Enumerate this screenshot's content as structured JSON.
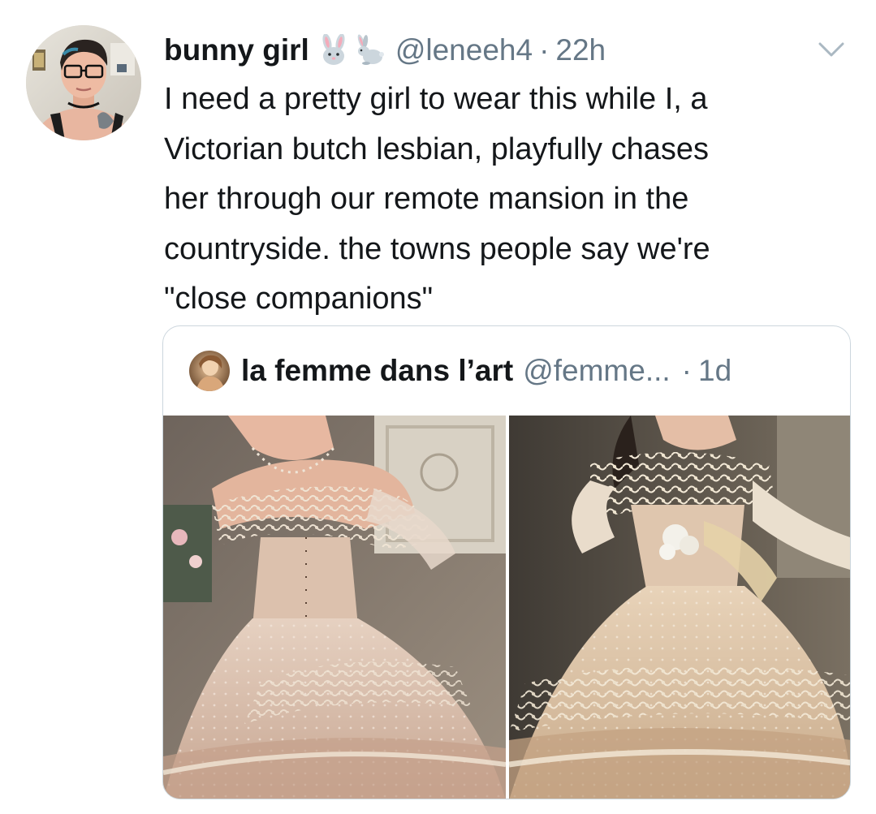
{
  "tweet": {
    "display_name": "bunny girl",
    "emojis": [
      "rabbit-face-emoji",
      "rabbit-emoji"
    ],
    "handle": "@leneeh4",
    "separator": "·",
    "time": "22h",
    "text": "I need a pretty girl to wear this while I, a\nVictorian butch lesbian, playfully chases\nher through our remote mansion in the\ncountryside. the towns people say we're\n\"close companions\""
  },
  "quoted_tweet": {
    "display_name": "la femme dans l’art",
    "handle": "@femme...",
    "separator": "·",
    "time": "1d",
    "media": [
      "lace-gown-photo-left",
      "lace-gown-photo-right"
    ]
  },
  "colors": {
    "text_primary": "#14171a",
    "text_secondary": "#657786",
    "border": "#ccd6dd",
    "caret": "#aab8c2"
  }
}
